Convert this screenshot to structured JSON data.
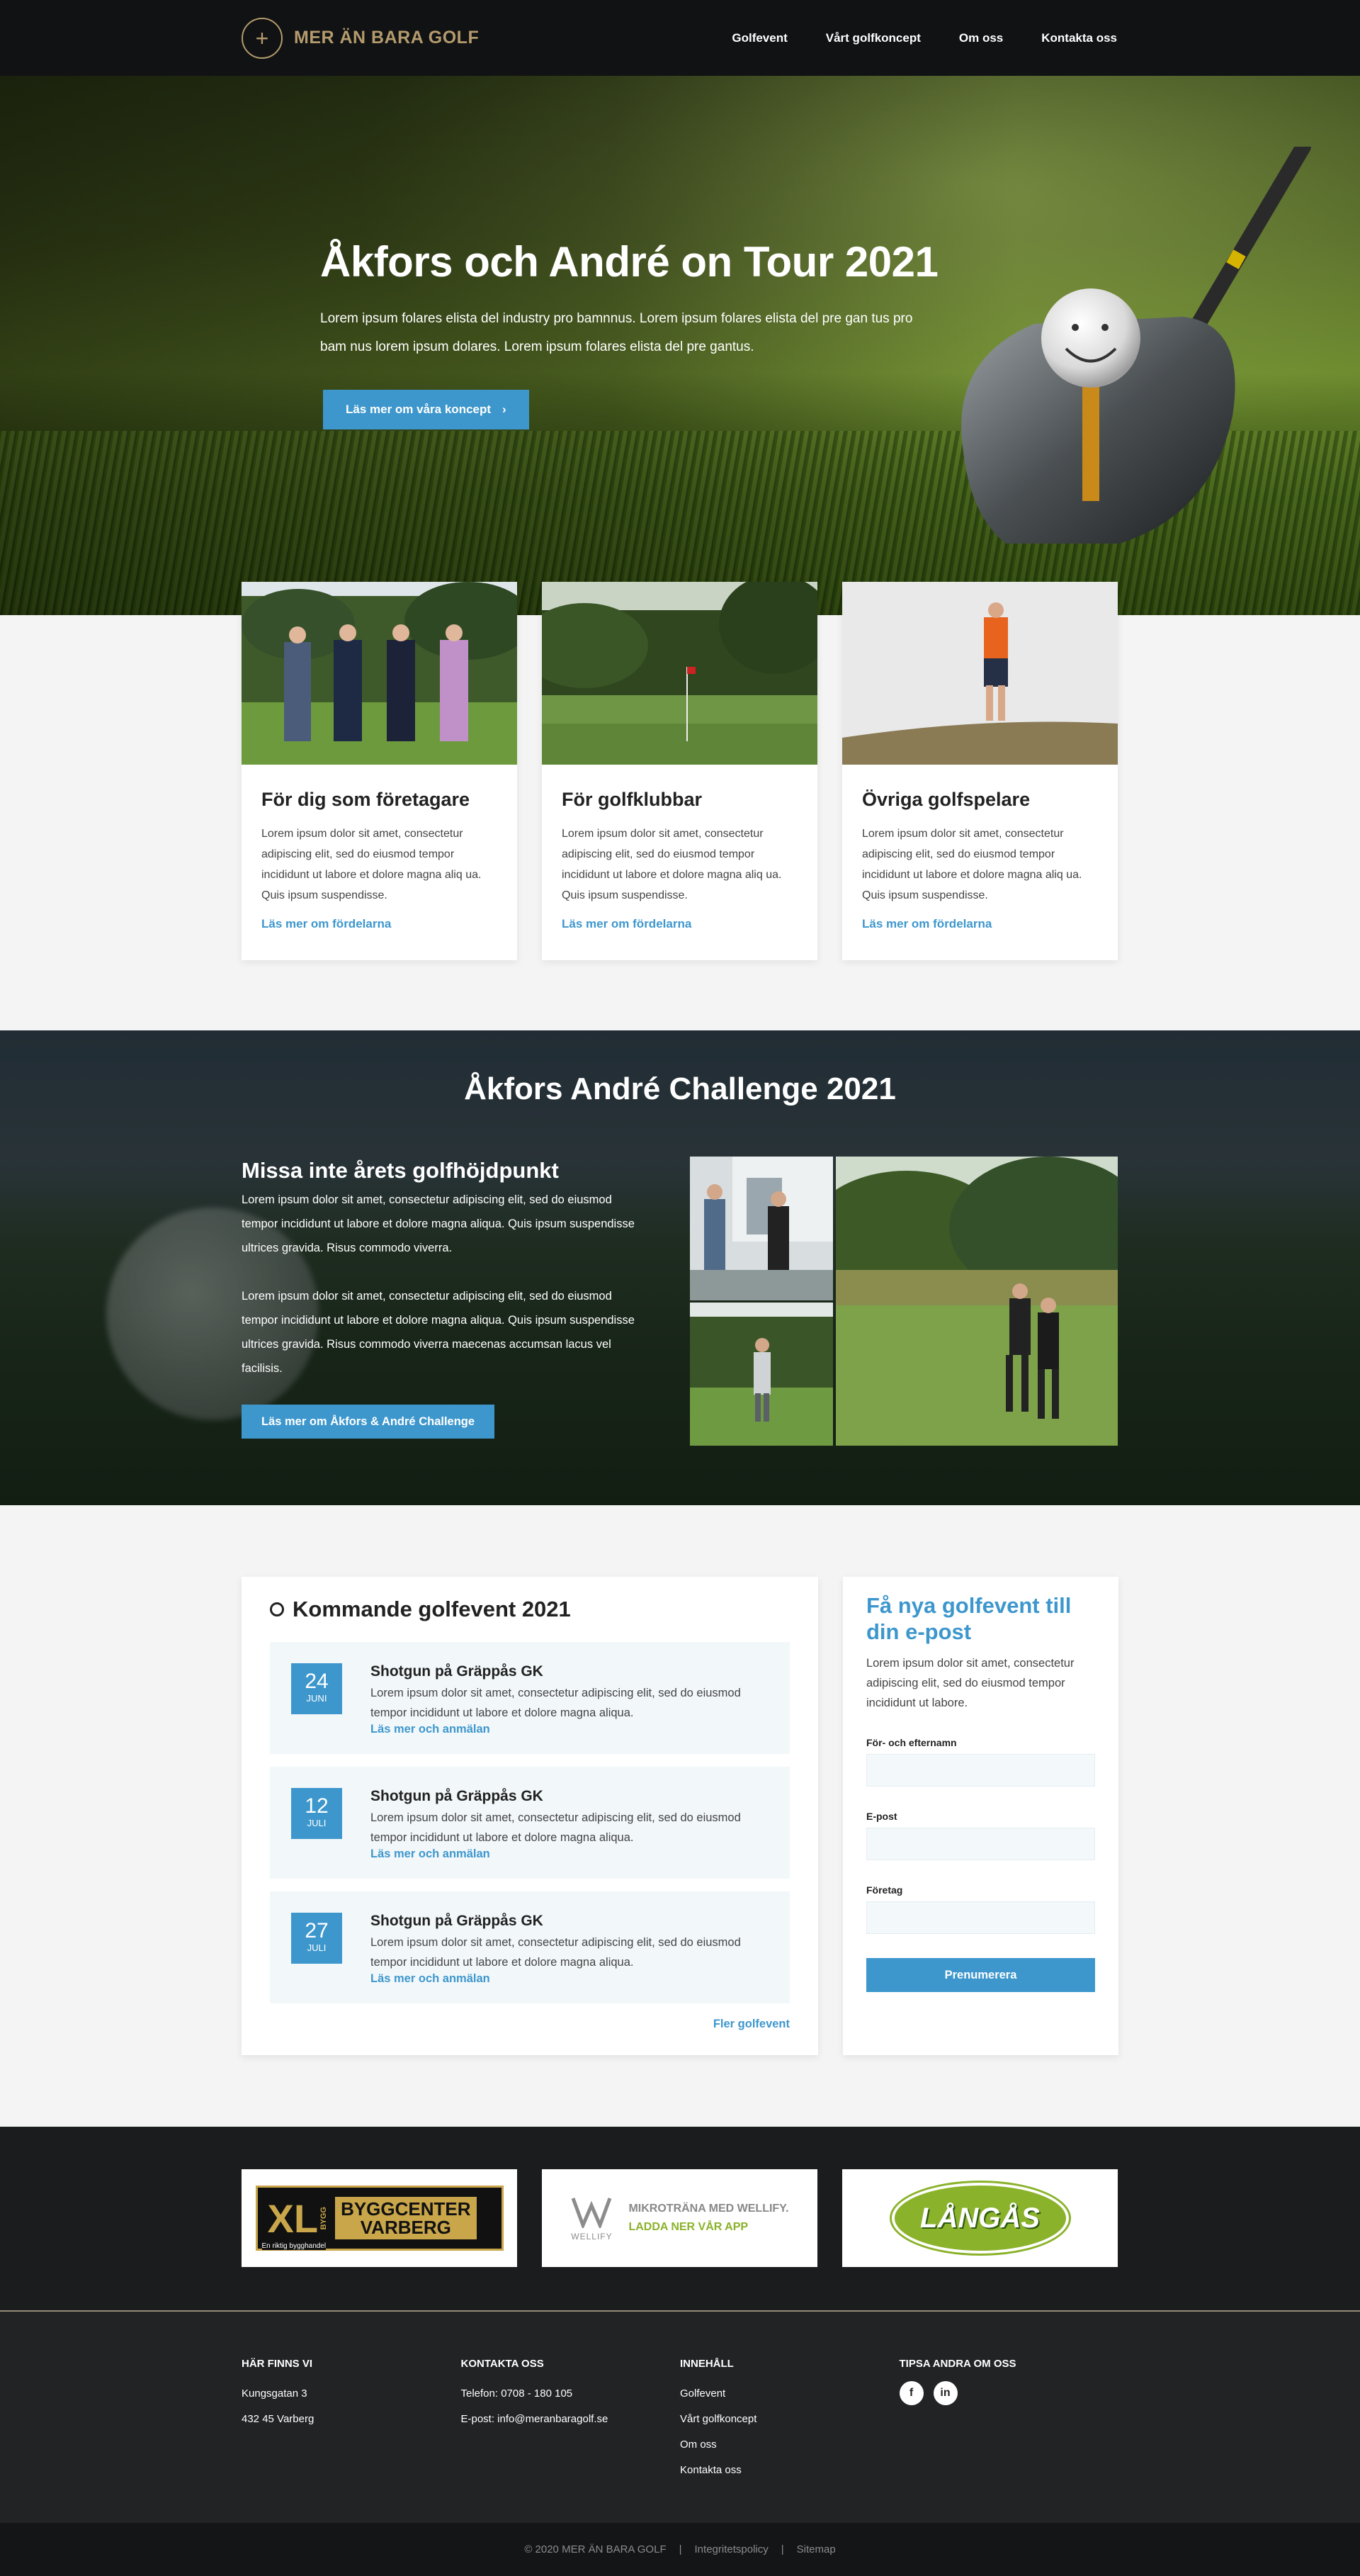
{
  "header": {
    "logo_text": "MER ÄN BARA GOLF",
    "nav": [
      "Golfevent",
      "Vårt golfkoncept",
      "Om oss",
      "Kontakta oss"
    ]
  },
  "hero": {
    "title": "Åkfors och André on Tour 2021",
    "text": "Lorem ipsum folares elista del industry pro bamnnus. Lorem ipsum folares elista del pre gan tus pro bam nus lorem ipsum dolares. Lorem ipsum folares elista del pre gantus.",
    "button": "Läs mer om våra koncept"
  },
  "cards": [
    {
      "title": "För dig som företagare",
      "text": "Lorem ipsum dolor sit amet, consectetur adipiscing elit, sed do eiusmod tempor incididunt ut labore et dolore magna aliq ua. Quis ipsum suspendisse.",
      "link": "Läs mer om fördelarna"
    },
    {
      "title": "För golfklubbar",
      "text": "Lorem ipsum dolor sit amet, consectetur adipiscing elit, sed do eiusmod tempor incididunt ut labore et dolore magna aliq ua. Quis ipsum suspendisse.",
      "link": "Läs mer om fördelarna"
    },
    {
      "title": "Övriga golfspelare",
      "text": "Lorem ipsum dolor sit amet, consectetur adipiscing elit, sed do eiusmod tempor incididunt ut labore et dolore magna aliq ua. Quis ipsum suspendisse.",
      "link": "Läs mer om fördelarna"
    }
  ],
  "challenge": {
    "title": "Åkfors André Challenge 2021",
    "subtitle": "Missa inte årets golfhöjdpunkt",
    "p1": "Lorem ipsum dolor sit amet, consectetur adipiscing elit, sed do eius­mod tempor incididunt ut labore et dolore magna aliqua. Quis ipsum suspendisse ultrices gravida. Risus commodo viverra.",
    "p2": "Lorem ipsum dolor sit amet, consectetur adipiscing elit, sed do eius­mod tempor incididunt ut labore et dolore magna aliqua. Quis ipsum suspendisse ultrices gravida. Risus commodo viverra maecenas ac­cumsan lacus vel facilisis.",
    "button": "Läs mer om Åkfors & André Challenge"
  },
  "events": {
    "title": "Kommande golfevent 2021",
    "items": [
      {
        "day": "24",
        "month": "JUNI",
        "title": "Shotgun på Gräppås GK",
        "text": "Lorem ipsum dolor sit amet, consectetur adipiscing elit, sed do eiusmod tempor incididunt ut labore et dolore magna aliqua.",
        "link": "Läs mer och anmälan"
      },
      {
        "day": "12",
        "month": "JULI",
        "title": "Shotgun på Gräppås GK",
        "text": "Lorem ipsum dolor sit amet, consectetur adipiscing elit, sed do eiusmod tempor incididunt ut labore et dolore magna aliqua.",
        "link": "Läs mer och anmälan"
      },
      {
        "day": "27",
        "month": "JULI",
        "title": "Shotgun på Gräppås GK",
        "text": "Lorem ipsum dolor sit amet, consectetur adipiscing elit, sed do eiusmod tempor incididunt ut labore et dolore magna aliqua.",
        "link": "Läs mer och anmälan"
      }
    ],
    "more": "Fler golfevent"
  },
  "subscribe": {
    "title": "Få nya golfevent till din e-post",
    "text": "Lorem ipsum dolor sit amet, consec­tetur adipiscing elit, sed do eiusmod tempor incididunt ut labore.",
    "label_name": "För- och efternamn",
    "label_email": "E-post",
    "label_company": "Företag",
    "button": "Prenumerera"
  },
  "partners": {
    "xl_mark": "XL",
    "xl_small": "BYGG",
    "xl_line1": "BYGGCENTER",
    "xl_line2": "VARBERG",
    "xl_tag": "En riktig bygghandel",
    "wellify_name": "WELLIFY",
    "wellify_line1": "MIKROTRÄNA MED WELLIFY.",
    "wellify_line2": "LADDA NER VÅR APP",
    "langas": "LÅNGÅS"
  },
  "footer": {
    "col1_title": "HÄR FINNS VI",
    "col1_lines": [
      "Kungsgatan 3",
      "432 45 Varberg"
    ],
    "col2_title": "KONTAKTA OSS",
    "col2_lines": [
      "Telefon: 0708 - 180 105",
      "E-post: info@meranbaragolf.se"
    ],
    "col3_title": "INNEHÅLL",
    "col3_lines": [
      "Golfevent",
      "Vårt golfkoncept",
      "Om oss",
      "Kontakta oss"
    ],
    "col4_title": "TIPSA ANDRA OM OSS",
    "social": [
      "facebook-icon",
      "linkedin-icon"
    ],
    "social_glyphs": [
      "f",
      "in"
    ]
  },
  "bottom": {
    "copyright": "© 2020 MER ÄN BARA GOLF",
    "links": [
      "Integritetspolicy",
      "Sitemap"
    ]
  }
}
